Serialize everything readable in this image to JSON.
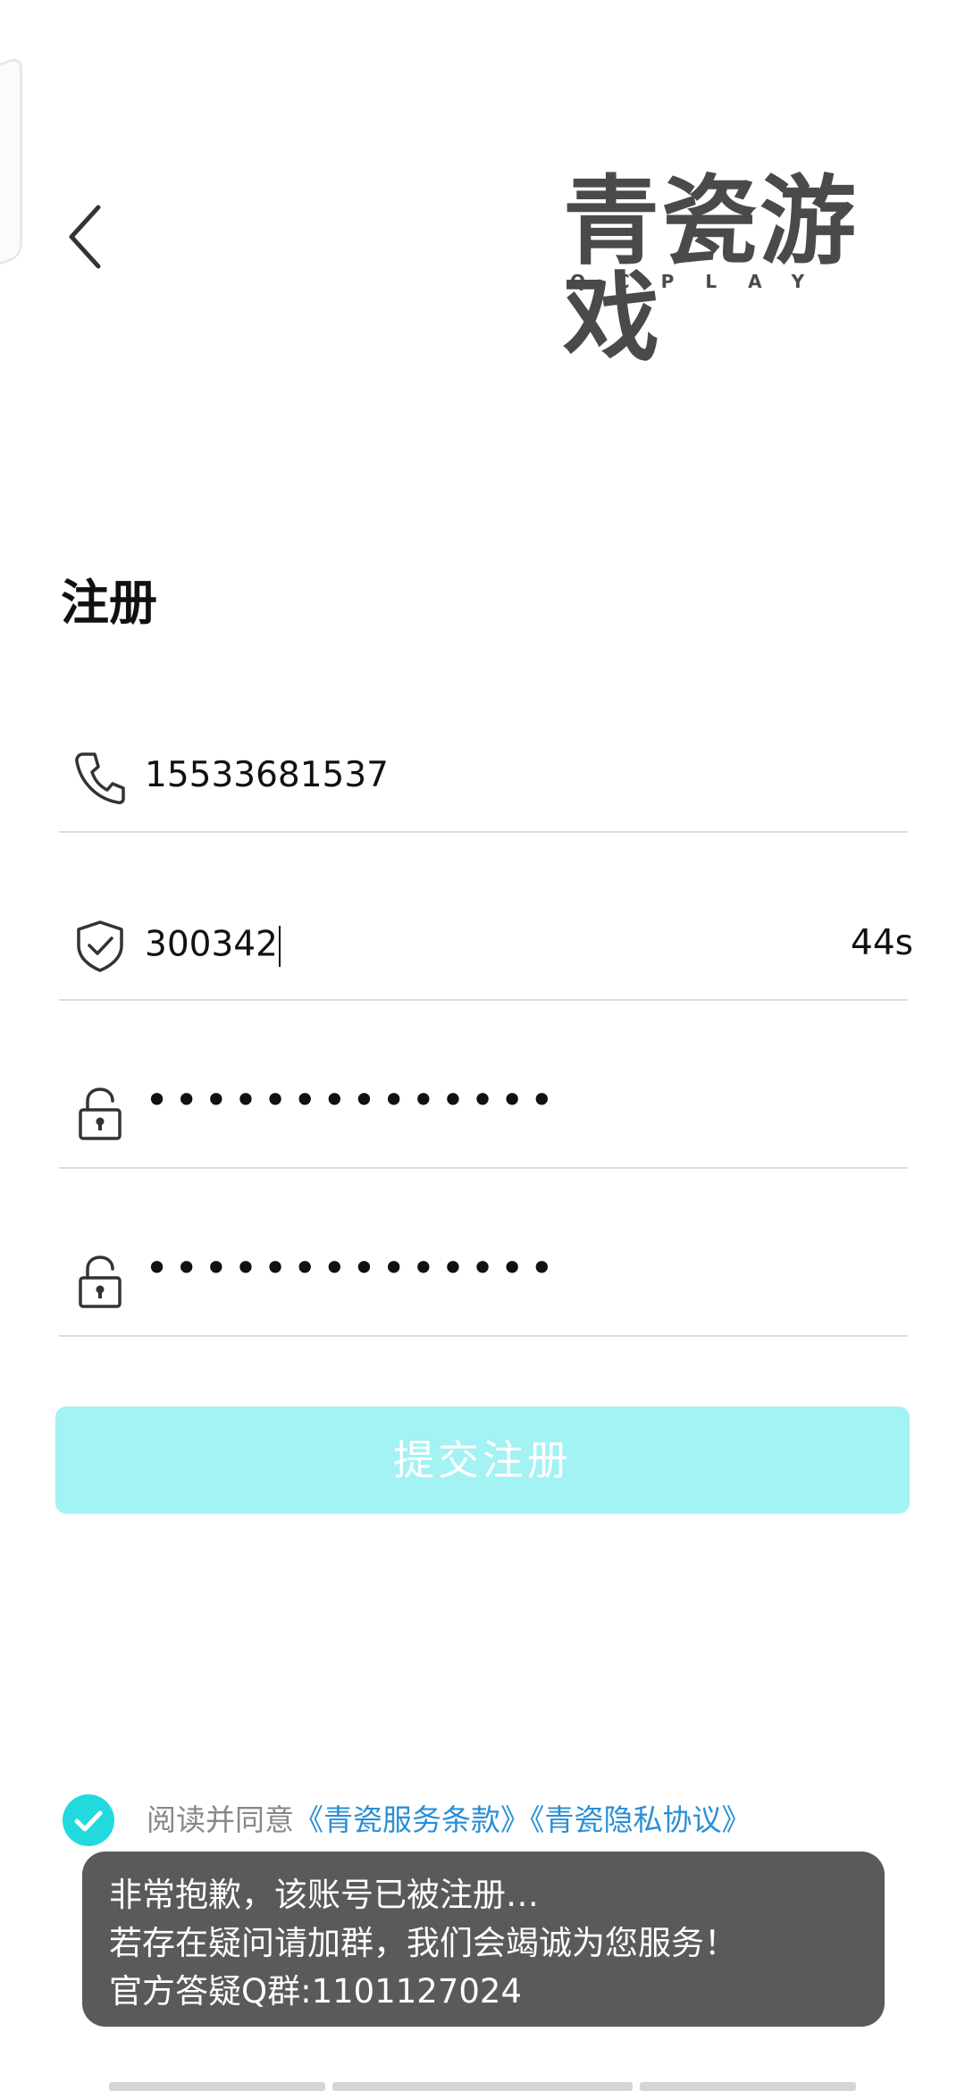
{
  "header": {
    "logo_main": "青瓷游戏",
    "logo_sub": "QCPLAY"
  },
  "form": {
    "title": "注册",
    "phone_value": "15533681537",
    "code_value": "300342",
    "countdown": "44s",
    "password_masked": "••••••••••••••",
    "confirm_password_masked": "••••••••••••••",
    "submit_label": "提交注册"
  },
  "agreement": {
    "checked": true,
    "text": "阅读并同意",
    "link_terms": "《青瓷服务条款》",
    "link_privacy": "《青瓷隐私协议》"
  },
  "toast": {
    "line1": "非常抱歉，该账号已被注册…",
    "line2": "若存在疑问请加群，我们会竭诚为您服务！",
    "line3": "官方答疑Q群:1101127024"
  },
  "icons": {
    "back": "chevron-left-icon",
    "phone": "phone-icon",
    "code": "shield-check-icon",
    "password": "lock-icon",
    "confirm": "lock-icon",
    "check": "check-icon"
  },
  "colors": {
    "submit_bg": "#a3f2f4",
    "check_bg": "#22d9de",
    "link": "#2a8fd6",
    "toast_bg": "#5a5a5a"
  }
}
